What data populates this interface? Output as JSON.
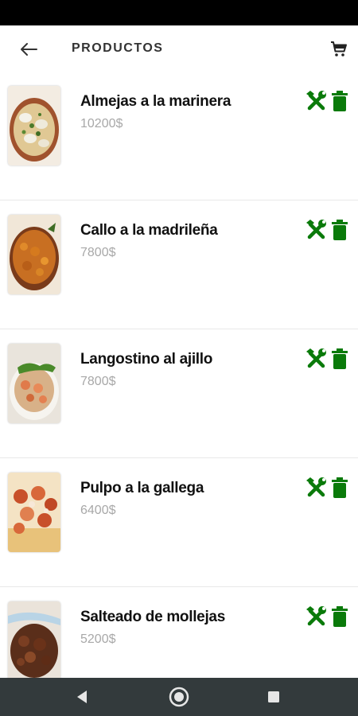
{
  "app_bar": {
    "title": "PRODUCTOS",
    "back_icon": "arrow-left-icon",
    "cart_icon": "cart-icon"
  },
  "accent_color": "#0a7a0a",
  "products": [
    {
      "name": "Almejas a la marinera",
      "price": "10200$",
      "image": "clams-dish-photo"
    },
    {
      "name": "Callo a la madrileña",
      "price": "7800$",
      "image": "tripe-stew-photo"
    },
    {
      "name": "Langostino al ajillo",
      "price": "7800$",
      "image": "garlic-prawns-photo"
    },
    {
      "name": "Pulpo a la gallega",
      "price": "6400$",
      "image": "galician-octopus-photo"
    },
    {
      "name": "Salteado de mollejas",
      "price": "5200$",
      "image": "sauteed-sweetbreads-photo"
    }
  ],
  "item_actions": {
    "edit_icon": "tools-icon",
    "delete_icon": "trash-icon"
  },
  "nav_bar": {
    "icons": [
      "nav-back-icon",
      "nav-home-icon",
      "nav-recents-icon"
    ]
  }
}
